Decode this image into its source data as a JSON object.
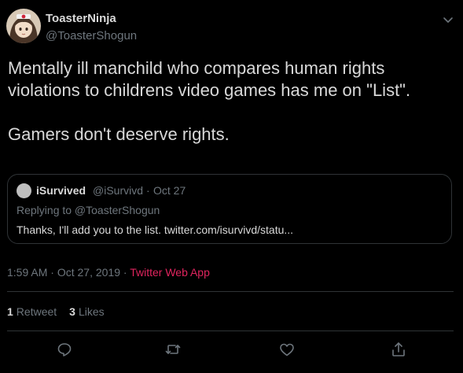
{
  "author": {
    "name": "ToasterNinja",
    "handle": "@ToasterShogun"
  },
  "tweet": {
    "lines": [
      "Mentally ill manchild who compares human rights",
      "violations to childrens video games has me on \"List\".",
      "",
      "Gamers don't deserve rights."
    ]
  },
  "quoted_tweet": {
    "name": "iSurvived",
    "handle": "@iSurvivd",
    "separator": "·",
    "date": "Oct 27",
    "replying_to": "Replying to @ToasterShogun",
    "text": "Thanks, I'll add you to the list. twitter.com/isurvivd/statu..."
  },
  "meta": {
    "time": "1:59 AM",
    "separator1": "·",
    "date": "Oct 27, 2019",
    "separator2": "·",
    "source": "Twitter Web App"
  },
  "stats": {
    "retweets_count": "1",
    "retweets_label": "Retweet",
    "likes_count": "3",
    "likes_label": "Likes"
  },
  "actions": [
    {
      "icon": "reply-icon"
    },
    {
      "icon": "retweet-icon"
    },
    {
      "icon": "like-icon"
    },
    {
      "icon": "share-icon"
    }
  ],
  "colors": {
    "background": "#000000",
    "text": "#d9d9d9",
    "secondary_text": "#6e767d",
    "border": "#2f3336",
    "source_link": "#e0245e"
  }
}
